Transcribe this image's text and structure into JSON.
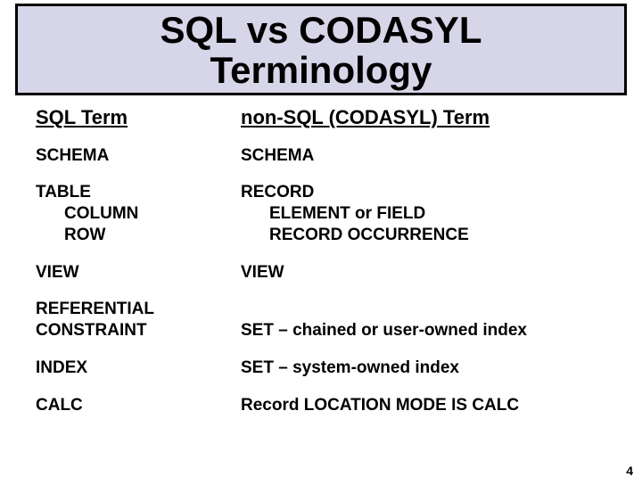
{
  "title": {
    "line1": "SQL vs CODASYL",
    "line2": "Terminology"
  },
  "headers": {
    "left": "SQL Term",
    "right": "non-SQL (CODASYL) Term"
  },
  "rows": [
    {
      "left_lines": [
        "SCHEMA"
      ],
      "right_lines": [
        "SCHEMA"
      ]
    },
    {
      "left_lines": [
        "TABLE",
        "COLUMN",
        "ROW"
      ],
      "left_indent": [
        false,
        true,
        true
      ],
      "right_lines": [
        "RECORD",
        "ELEMENT or FIELD",
        "RECORD OCCURRENCE"
      ],
      "right_indent": [
        false,
        true,
        true
      ]
    },
    {
      "left_lines": [
        "VIEW"
      ],
      "right_lines": [
        "VIEW"
      ]
    },
    {
      "left_lines": [
        "REFERENTIAL",
        "CONSTRAINT"
      ],
      "right_lines": [
        "",
        "SET – chained or user-owned index"
      ]
    },
    {
      "left_lines": [
        "INDEX"
      ],
      "right_lines": [
        "SET – system-owned index"
      ]
    },
    {
      "left_lines": [
        "CALC"
      ],
      "right_lines": [
        "Record LOCATION MODE IS CALC"
      ]
    }
  ],
  "page_number": "4"
}
